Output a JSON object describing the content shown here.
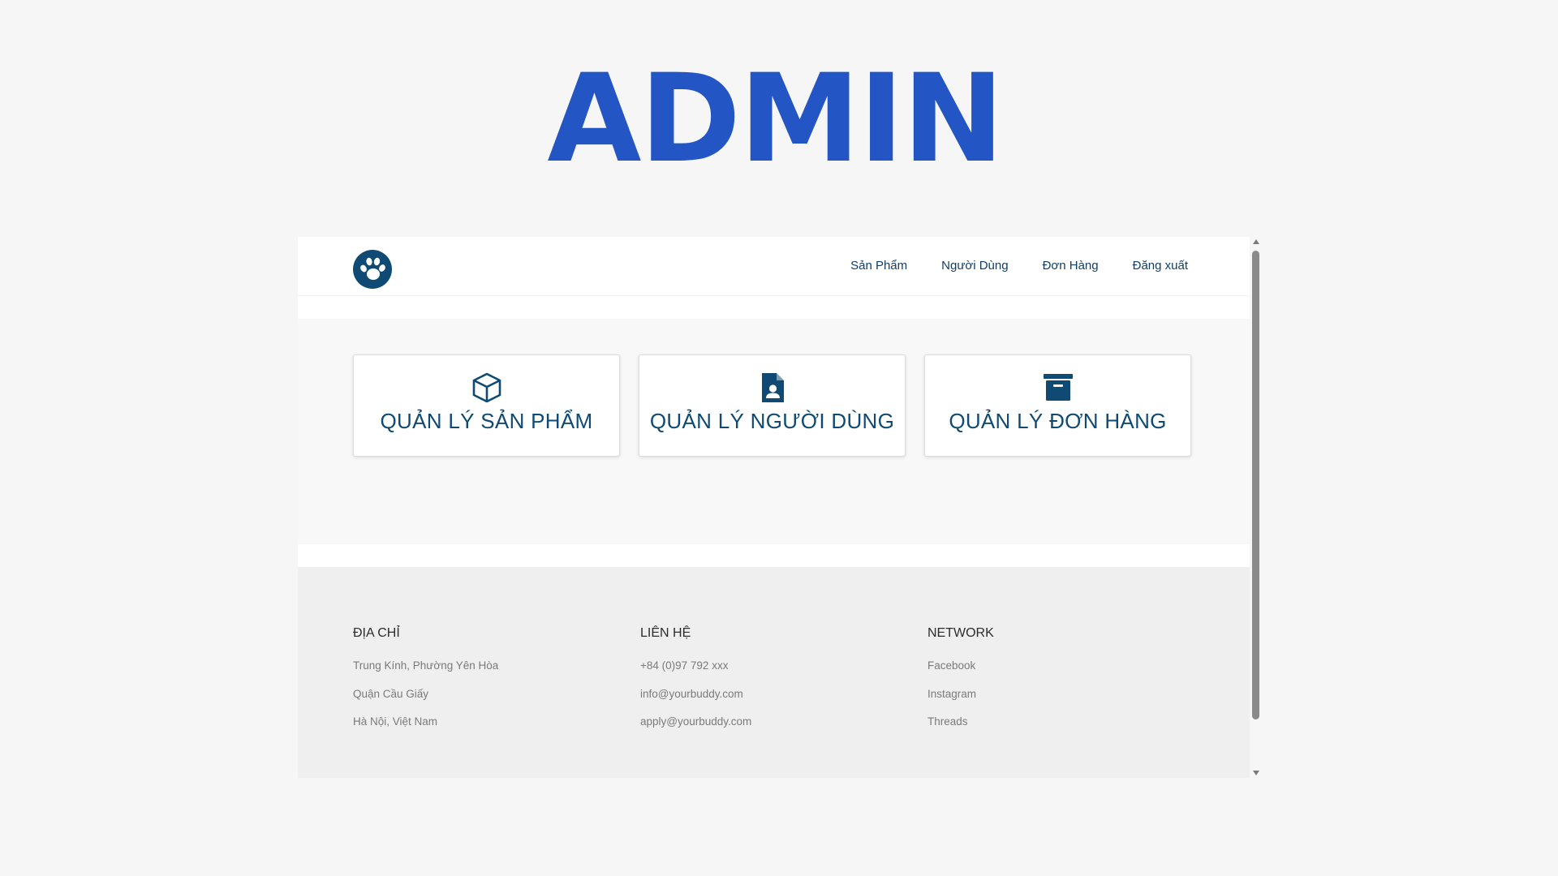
{
  "page": {
    "title": "ADMIN"
  },
  "navbar": {
    "logo_icon": "paw-icon",
    "links": [
      {
        "label": "Sản Phẩm"
      },
      {
        "label": "Người Dùng"
      },
      {
        "label": "Đơn Hàng"
      },
      {
        "label": "Đăng xuất"
      }
    ]
  },
  "cards": [
    {
      "icon": "box-icon",
      "label": "QUẢN LÝ SẢN PHẨM"
    },
    {
      "icon": "user-file-icon",
      "label": "QUẢN LÝ NGƯỜI DÙNG"
    },
    {
      "icon": "archive-icon",
      "label": "QUẢN LÝ ĐƠN HÀNG"
    }
  ],
  "footer": {
    "address": {
      "heading": "ĐỊA CHỈ",
      "lines": [
        "Trung Kính, Phường Yên Hòa",
        "Quận Cầu Giấy",
        "Hà Nội, Việt Nam"
      ]
    },
    "contact": {
      "heading": "LIÊN HỆ",
      "lines": [
        "+84 (0)97 792 xxx",
        "info@yourbuddy.com",
        "apply@yourbuddy.com"
      ]
    },
    "network": {
      "heading": "NETWORK",
      "links": [
        "Facebook",
        "Instagram",
        "Threads"
      ]
    }
  },
  "colors": {
    "title_blue": "#2355c4",
    "navy": "#0e4a74",
    "page_bg": "#f6f6f6",
    "footer_bg": "#efefef"
  }
}
